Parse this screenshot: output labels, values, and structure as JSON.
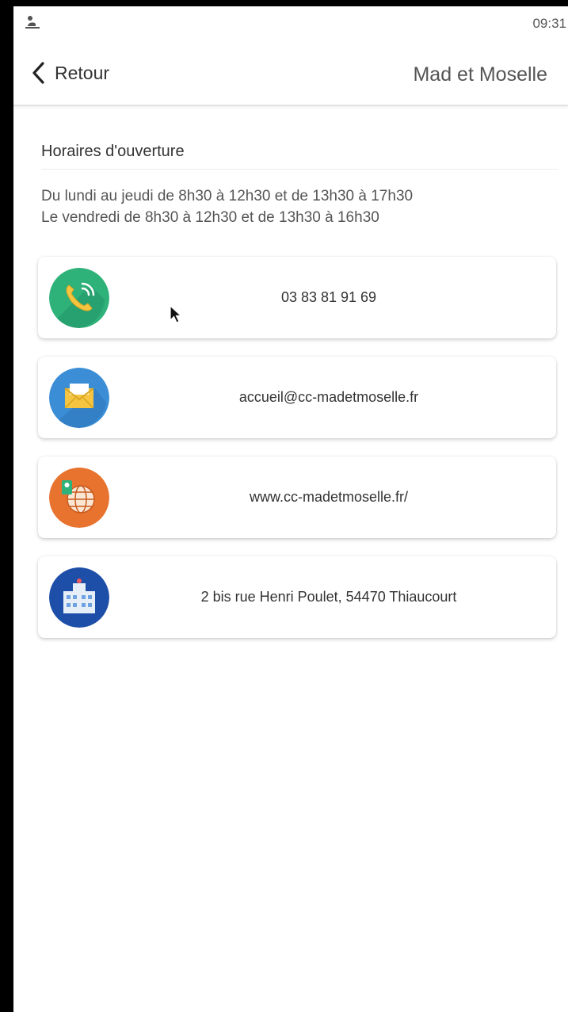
{
  "statusbar": {
    "time": "09:31"
  },
  "header": {
    "back_label": "Retour",
    "title": "Mad et Moselle"
  },
  "hours_section": {
    "title": "Horaires d'ouverture",
    "line1": "Du lundi au jeudi de 8h30 à 12h30 et de 13h30 à 17h30",
    "line2": "Le vendredi de 8h30 à 12h30 et de 13h30 à 16h30"
  },
  "contacts": [
    {
      "icon": "phone-icon",
      "label": "03 83 81 91 69",
      "color": "#2fb27a"
    },
    {
      "icon": "mail-icon",
      "label": "accueil@cc-madetmoselle.fr",
      "color": "#3b8ed6"
    },
    {
      "icon": "globe-icon",
      "label": "www.cc-madetmoselle.fr/",
      "color": "#e8732f"
    },
    {
      "icon": "building-icon",
      "label": "2 bis rue Henri Poulet, 54470 Thiaucourt",
      "color": "#1d4fa8"
    }
  ]
}
